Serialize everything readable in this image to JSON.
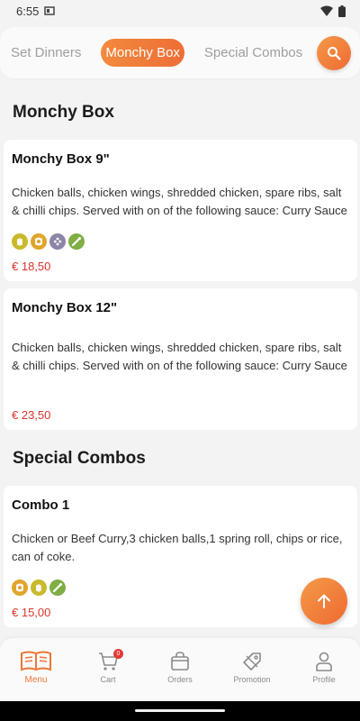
{
  "status_bar": {
    "time": "6:55"
  },
  "tabs": [
    {
      "label": "Set Dinners",
      "active": false
    },
    {
      "label": "Monchy Box",
      "active": true
    },
    {
      "label": "Special Combos",
      "active": false
    }
  ],
  "search": {
    "icon": "search-icon"
  },
  "sections": [
    {
      "title": "Monchy Box",
      "items": [
        {
          "name": "Monchy Box 9\"",
          "description_line1": "Chicken balls, chicken wings, shredded chicken, spare ribs, salt",
          "description_line2": "& chilli chips. Served with on of the following sauce: Curry Sauce",
          "allergens": [
            "gluten-icon",
            "egg-icon",
            "soy-icon",
            "celery-icon"
          ],
          "price": "€ 18,50"
        },
        {
          "name": "Monchy Box 12\"",
          "description_line1": "Chicken balls, chicken wings, shredded chicken, spare ribs, salt",
          "description_line2": "& chilli chips. Served with on of the following sauce: Curry Sauce",
          "allergens": [],
          "price": "€ 23,50"
        }
      ]
    },
    {
      "title": "Special Combos",
      "items": [
        {
          "name": "Combo 1",
          "description_line1": "Chicken or Beef Curry,3 chicken balls,1 spring roll, chips or rice,",
          "description_line2": "can of coke.",
          "allergens": [
            "egg-icon",
            "gluten-icon",
            "celery-icon"
          ],
          "price": "€ 15,00"
        }
      ]
    }
  ],
  "bottom_nav": [
    {
      "label": "Menu",
      "icon": "menu-book-icon",
      "active": true
    },
    {
      "label": "Cart",
      "icon": "cart-icon",
      "active": false,
      "badge": "0"
    },
    {
      "label": "Orders",
      "icon": "orders-bag-icon",
      "active": false
    },
    {
      "label": "Promotion",
      "icon": "promotion-tag-icon",
      "active": false
    },
    {
      "label": "Profile",
      "icon": "profile-icon",
      "active": false
    }
  ],
  "colors": {
    "accent": "#ee7636",
    "price": "#d9352b",
    "allergen_gluten": "#c9b92c",
    "allergen_egg": "#e0a52a",
    "allergen_soy": "#8d85a8",
    "allergen_celery": "#7fae45"
  }
}
